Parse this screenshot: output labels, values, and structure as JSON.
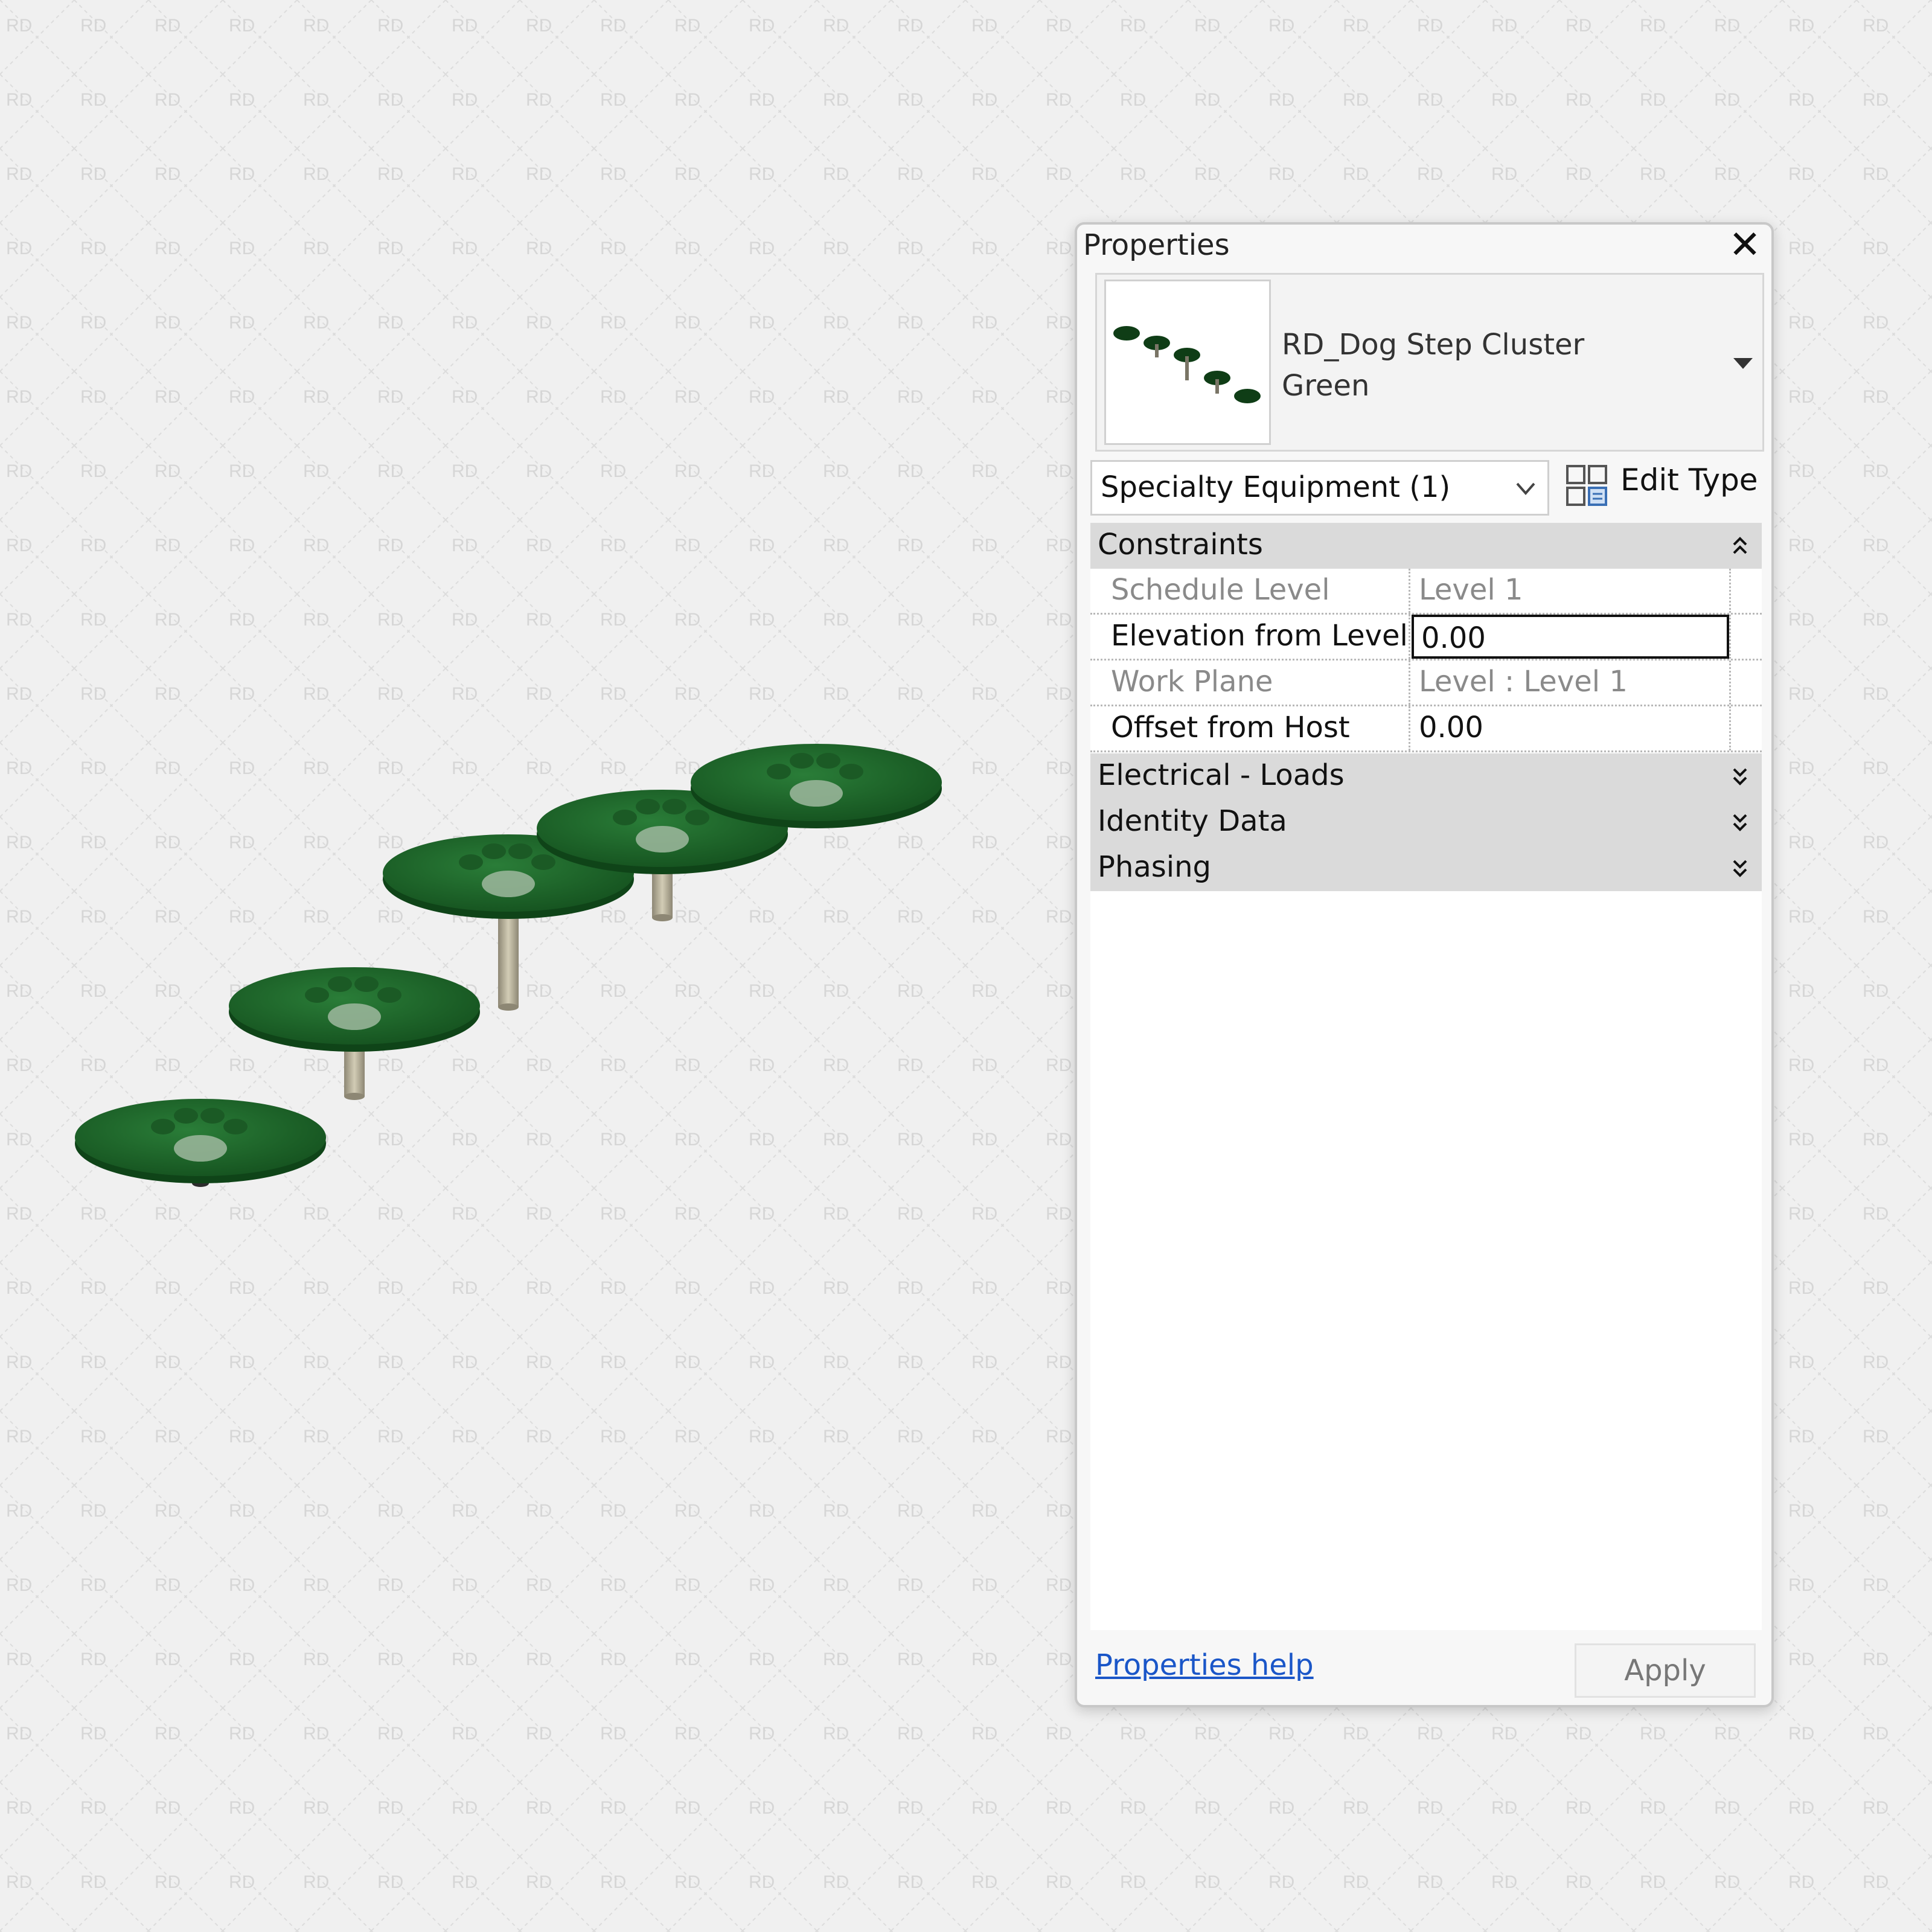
{
  "watermark": {
    "text": "RD"
  },
  "panel": {
    "title": "Properties",
    "type_selector": {
      "family": "RD_Dog Step Cluster",
      "type": "Green"
    },
    "category": {
      "selected": "Specialty Equipment (1)"
    },
    "edit_type_label": "Edit Type",
    "sections": [
      {
        "label": "Constraints",
        "state": "expanded"
      },
      {
        "label": "Electrical - Loads",
        "state": "collapsed"
      },
      {
        "label": "Identity Data",
        "state": "collapsed"
      },
      {
        "label": "Phasing",
        "state": "collapsed"
      }
    ],
    "constraints": [
      {
        "name": "Schedule Level",
        "value": "Level 1",
        "readonly": true
      },
      {
        "name": "Elevation from Level",
        "value": "0.00",
        "readonly": false
      },
      {
        "name": "Work Plane",
        "value": "Level : Level 1",
        "readonly": true
      },
      {
        "name": "Offset from Host",
        "value": "0.00",
        "readonly": false
      }
    ],
    "help_link": "Properties help",
    "apply_label": "Apply"
  },
  "colors": {
    "step_green": "#1f6b2c",
    "step_green_dark": "#0f4418",
    "post": "#b6b09a",
    "link": "#1a56c8",
    "section_bg": "#dadada"
  }
}
